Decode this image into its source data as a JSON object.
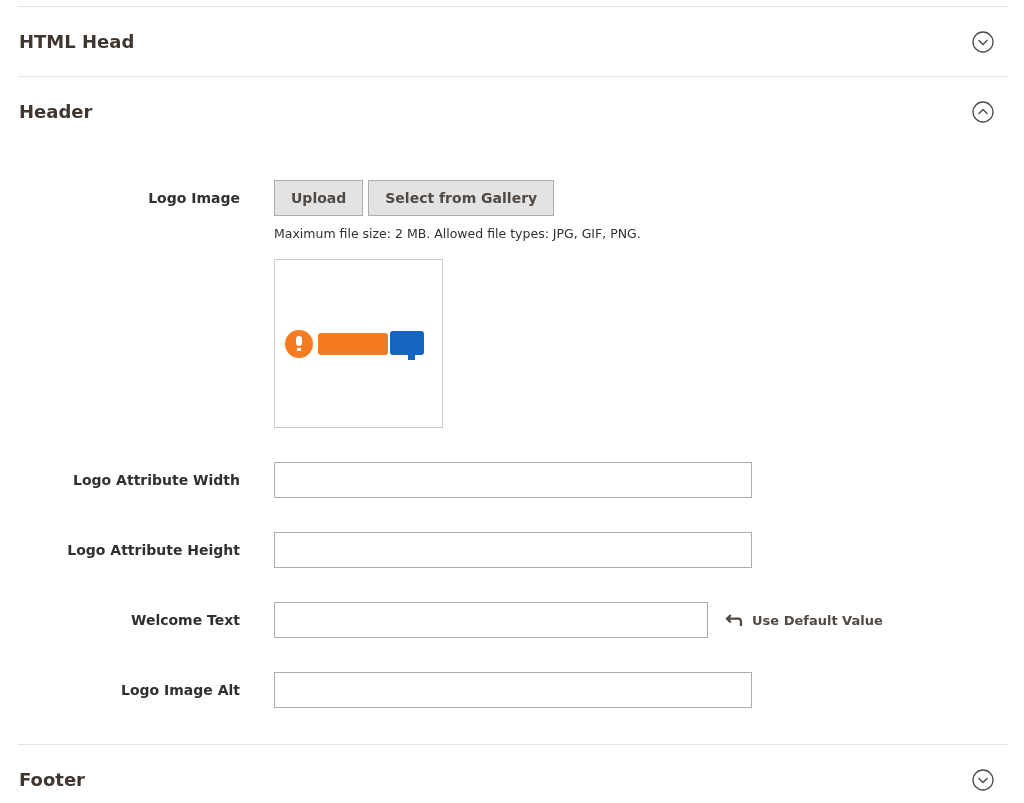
{
  "sections": [
    {
      "title": "HTML Head",
      "expanded": false
    },
    {
      "title": "Header",
      "expanded": true,
      "fields": [
        {
          "kind": "image_upload",
          "label": "Logo Image",
          "buttons": [
            "Upload",
            "Select from Gallery"
          ],
          "note": "Maximum file size: 2 MB. Allowed file types: JPG, GIF, PNG.",
          "preview": {
            "kind": "picture"
          }
        },
        {
          "kind": "text",
          "label": "Logo Attribute Width"
        },
        {
          "kind": "text",
          "label": "Logo Attribute Height"
        },
        {
          "kind": "text",
          "label": "Welcome Text",
          "use_default": "Use Default Value"
        },
        {
          "kind": "text",
          "label": "Logo Image Alt"
        }
      ]
    },
    {
      "title": "Footer",
      "expanded": false
    }
  ]
}
